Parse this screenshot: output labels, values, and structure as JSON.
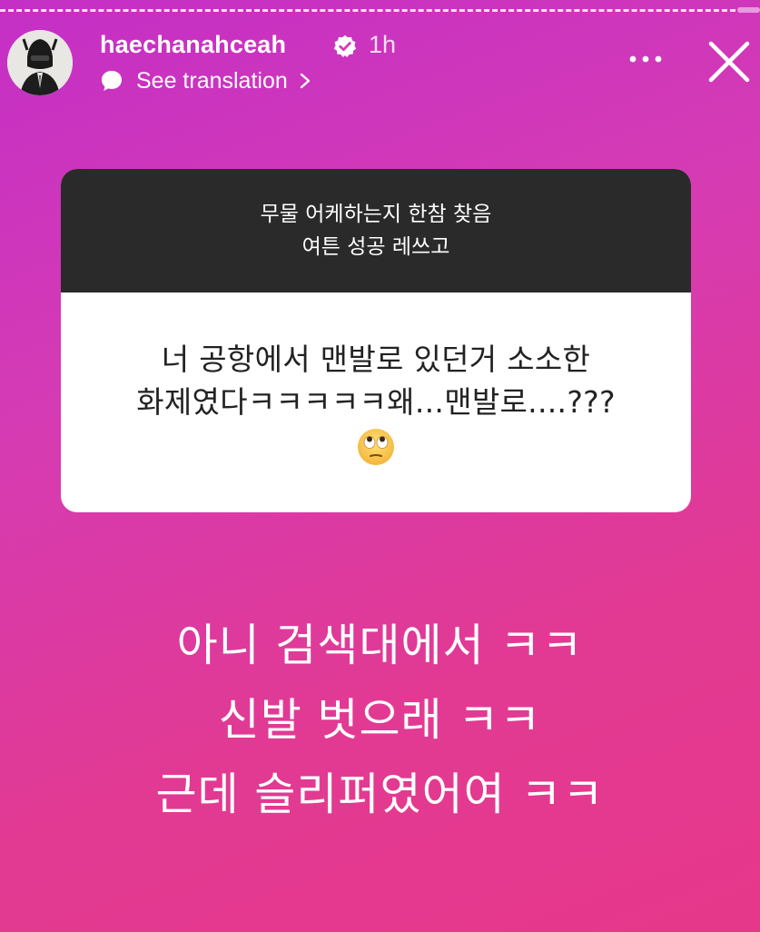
{
  "header": {
    "username": "haechanahceah",
    "time": "1h",
    "translate_label": "See translation",
    "icons": {
      "avatar": "profile-avatar",
      "verified": "verified-badge-icon",
      "translate": "speech-bubble-icon",
      "chevron": "chevron-right-icon",
      "more": "more-icon",
      "close": "close-icon"
    }
  },
  "question": {
    "prompt_lines": [
      "무물 어케하는지 한참 찾음",
      "여튼 성공 레쓰고"
    ],
    "body_lines": [
      "너 공항에서 맨발로 있던거 소소한",
      "화제였다ㅋㅋㅋㅋㅋ왜...맨발로....???"
    ],
    "emoji": "eye-roll-emoji"
  },
  "answer": {
    "lines": [
      "아니 검색대에서 ㅋㅋ",
      "신발 벗으래 ㅋㅋ",
      "근데 슬리퍼였어여 ㅋㅋ"
    ]
  },
  "colors": {
    "gradient_start": "#c42fc6",
    "gradient_end": "#e6388a",
    "card_header": "#2a2a2a",
    "card_body": "#ffffff"
  }
}
